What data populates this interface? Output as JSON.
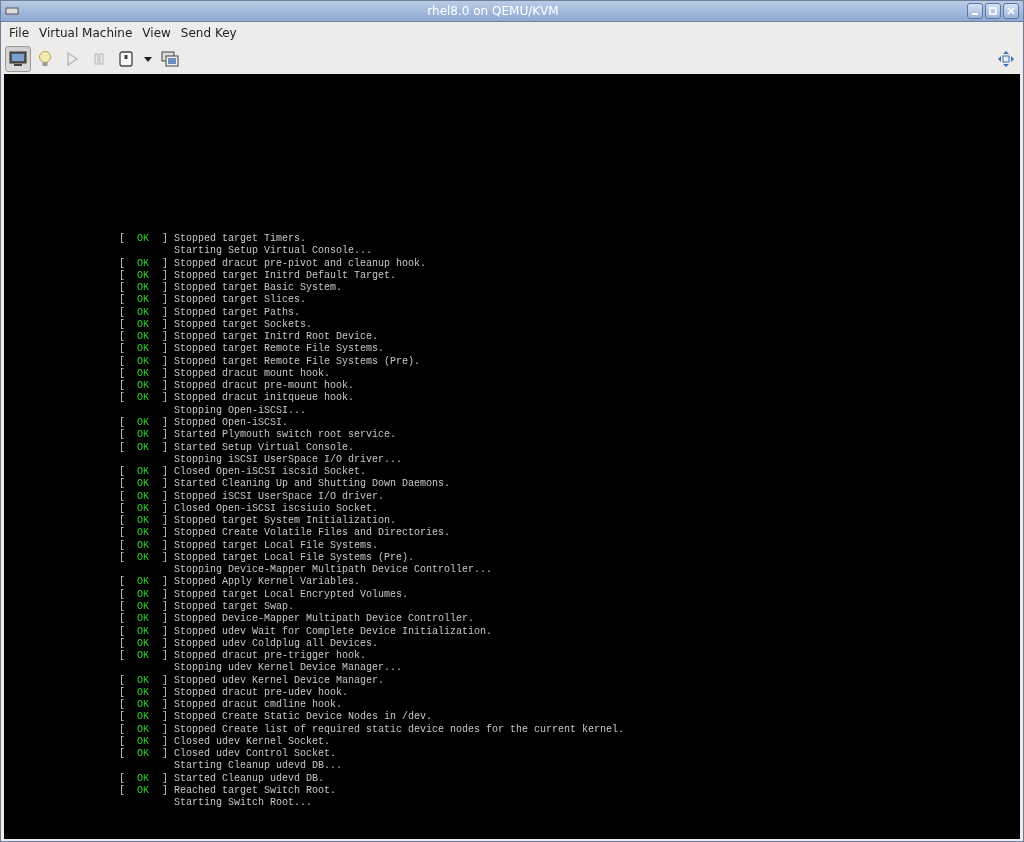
{
  "window": {
    "title": "rhel8.0 on QEMU/KVM"
  },
  "menu": [
    "File",
    "Virtual Machine",
    "View",
    "Send Key"
  ],
  "toolbar": [
    {
      "kind": "console",
      "selected": true,
      "disabled": false
    },
    {
      "kind": "details",
      "selected": false,
      "disabled": false
    },
    {
      "kind": "run",
      "selected": false,
      "disabled": true
    },
    {
      "kind": "pause",
      "selected": false,
      "disabled": true
    },
    {
      "kind": "power",
      "selected": false,
      "disabled": false
    },
    {
      "kind": "caret",
      "selected": false,
      "disabled": false
    },
    {
      "kind": "snapshots",
      "selected": false,
      "disabled": false
    }
  ],
  "console": {
    "lines": [
      {
        "kind": "status",
        "open": "[",
        "status": "OK",
        "close": "]",
        "message": "Stopped target Timers."
      },
      {
        "kind": "plain",
        "message": "Starting Setup Virtual Console..."
      },
      {
        "kind": "status",
        "open": "[",
        "status": "OK",
        "close": "]",
        "message": "Stopped dracut pre-pivot and cleanup hook."
      },
      {
        "kind": "status",
        "open": "[",
        "status": "OK",
        "close": "]",
        "message": "Stopped target Initrd Default Target."
      },
      {
        "kind": "status",
        "open": "[",
        "status": "OK",
        "close": "]",
        "message": "Stopped target Basic System."
      },
      {
        "kind": "status",
        "open": "[",
        "status": "OK",
        "close": "]",
        "message": "Stopped target Slices."
      },
      {
        "kind": "status",
        "open": "[",
        "status": "OK",
        "close": "]",
        "message": "Stopped target Paths."
      },
      {
        "kind": "status",
        "open": "[",
        "status": "OK",
        "close": "]",
        "message": "Stopped target Sockets."
      },
      {
        "kind": "status",
        "open": "[",
        "status": "OK",
        "close": "]",
        "message": "Stopped target Initrd Root Device."
      },
      {
        "kind": "status",
        "open": "[",
        "status": "OK",
        "close": "]",
        "message": "Stopped target Remote File Systems."
      },
      {
        "kind": "status",
        "open": "[",
        "status": "OK",
        "close": "]",
        "message": "Stopped target Remote File Systems (Pre)."
      },
      {
        "kind": "status",
        "open": "[",
        "status": "OK",
        "close": "]",
        "message": "Stopped dracut mount hook."
      },
      {
        "kind": "status",
        "open": "[",
        "status": "OK",
        "close": "]",
        "message": "Stopped dracut pre-mount hook."
      },
      {
        "kind": "status",
        "open": "[",
        "status": "OK",
        "close": "]",
        "message": "Stopped dracut initqueue hook."
      },
      {
        "kind": "plain",
        "message": "Stopping Open-iSCSI..."
      },
      {
        "kind": "status",
        "open": "[",
        "status": "OK",
        "close": "]",
        "message": "Stopped Open-iSCSI."
      },
      {
        "kind": "status",
        "open": "[",
        "status": "OK",
        "close": "]",
        "message": "Started Plymouth switch root service."
      },
      {
        "kind": "status",
        "open": "[",
        "status": "OK",
        "close": "]",
        "message": "Started Setup Virtual Console."
      },
      {
        "kind": "plain",
        "message": "Stopping iSCSI UserSpace I/O driver..."
      },
      {
        "kind": "status",
        "open": "[",
        "status": "OK",
        "close": "]",
        "message": "Closed Open-iSCSI iscsid Socket."
      },
      {
        "kind": "status",
        "open": "[",
        "status": "OK",
        "close": "]",
        "message": "Started Cleaning Up and Shutting Down Daemons."
      },
      {
        "kind": "status",
        "open": "[",
        "status": "OK",
        "close": "]",
        "message": "Stopped iSCSI UserSpace I/O driver."
      },
      {
        "kind": "status",
        "open": "[",
        "status": "OK",
        "close": "]",
        "message": "Closed Open-iSCSI iscsiuio Socket."
      },
      {
        "kind": "status",
        "open": "[",
        "status": "OK",
        "close": "]",
        "message": "Stopped target System Initialization."
      },
      {
        "kind": "status",
        "open": "[",
        "status": "OK",
        "close": "]",
        "message": "Stopped Create Volatile Files and Directories."
      },
      {
        "kind": "status",
        "open": "[",
        "status": "OK",
        "close": "]",
        "message": "Stopped target Local File Systems."
      },
      {
        "kind": "status",
        "open": "[",
        "status": "OK",
        "close": "]",
        "message": "Stopped target Local File Systems (Pre)."
      },
      {
        "kind": "plain",
        "message": "Stopping Device-Mapper Multipath Device Controller..."
      },
      {
        "kind": "status",
        "open": "[",
        "status": "OK",
        "close": "]",
        "message": "Stopped Apply Kernel Variables."
      },
      {
        "kind": "status",
        "open": "[",
        "status": "OK",
        "close": "]",
        "message": "Stopped target Local Encrypted Volumes."
      },
      {
        "kind": "status",
        "open": "[",
        "status": "OK",
        "close": "]",
        "message": "Stopped target Swap."
      },
      {
        "kind": "status",
        "open": "[",
        "status": "OK",
        "close": "]",
        "message": "Stopped Device-Mapper Multipath Device Controller."
      },
      {
        "kind": "status",
        "open": "[",
        "status": "OK",
        "close": "]",
        "message": "Stopped udev Wait for Complete Device Initialization."
      },
      {
        "kind": "status",
        "open": "[",
        "status": "OK",
        "close": "]",
        "message": "Stopped udev Coldplug all Devices."
      },
      {
        "kind": "status",
        "open": "[",
        "status": "OK",
        "close": "]",
        "message": "Stopped dracut pre-trigger hook."
      },
      {
        "kind": "plain",
        "message": "Stopping udev Kernel Device Manager..."
      },
      {
        "kind": "status",
        "open": "[",
        "status": "OK",
        "close": "]",
        "message": "Stopped udev Kernel Device Manager."
      },
      {
        "kind": "status",
        "open": "[",
        "status": "OK",
        "close": "]",
        "message": "Stopped dracut pre-udev hook."
      },
      {
        "kind": "status",
        "open": "[",
        "status": "OK",
        "close": "]",
        "message": "Stopped dracut cmdline hook."
      },
      {
        "kind": "status",
        "open": "[",
        "status": "OK",
        "close": "]",
        "message": "Stopped Create Static Device Nodes in /dev."
      },
      {
        "kind": "status",
        "open": "[",
        "status": "OK",
        "close": "]",
        "message": "Stopped Create list of required static device nodes for the current kernel."
      },
      {
        "kind": "status",
        "open": "[",
        "status": "OK",
        "close": "]",
        "message": "Closed udev Kernel Socket."
      },
      {
        "kind": "status",
        "open": "[",
        "status": "OK",
        "close": "]",
        "message": "Closed udev Control Socket."
      },
      {
        "kind": "plain",
        "message": "Starting Cleanup udevd DB..."
      },
      {
        "kind": "status",
        "open": "[",
        "status": "OK",
        "close": "]",
        "message": "Started Cleanup udevd DB."
      },
      {
        "kind": "status",
        "open": "[",
        "status": "OK",
        "close": "]",
        "message": "Reached target Switch Root."
      },
      {
        "kind": "plain",
        "message": "Starting Switch Root..."
      }
    ]
  }
}
